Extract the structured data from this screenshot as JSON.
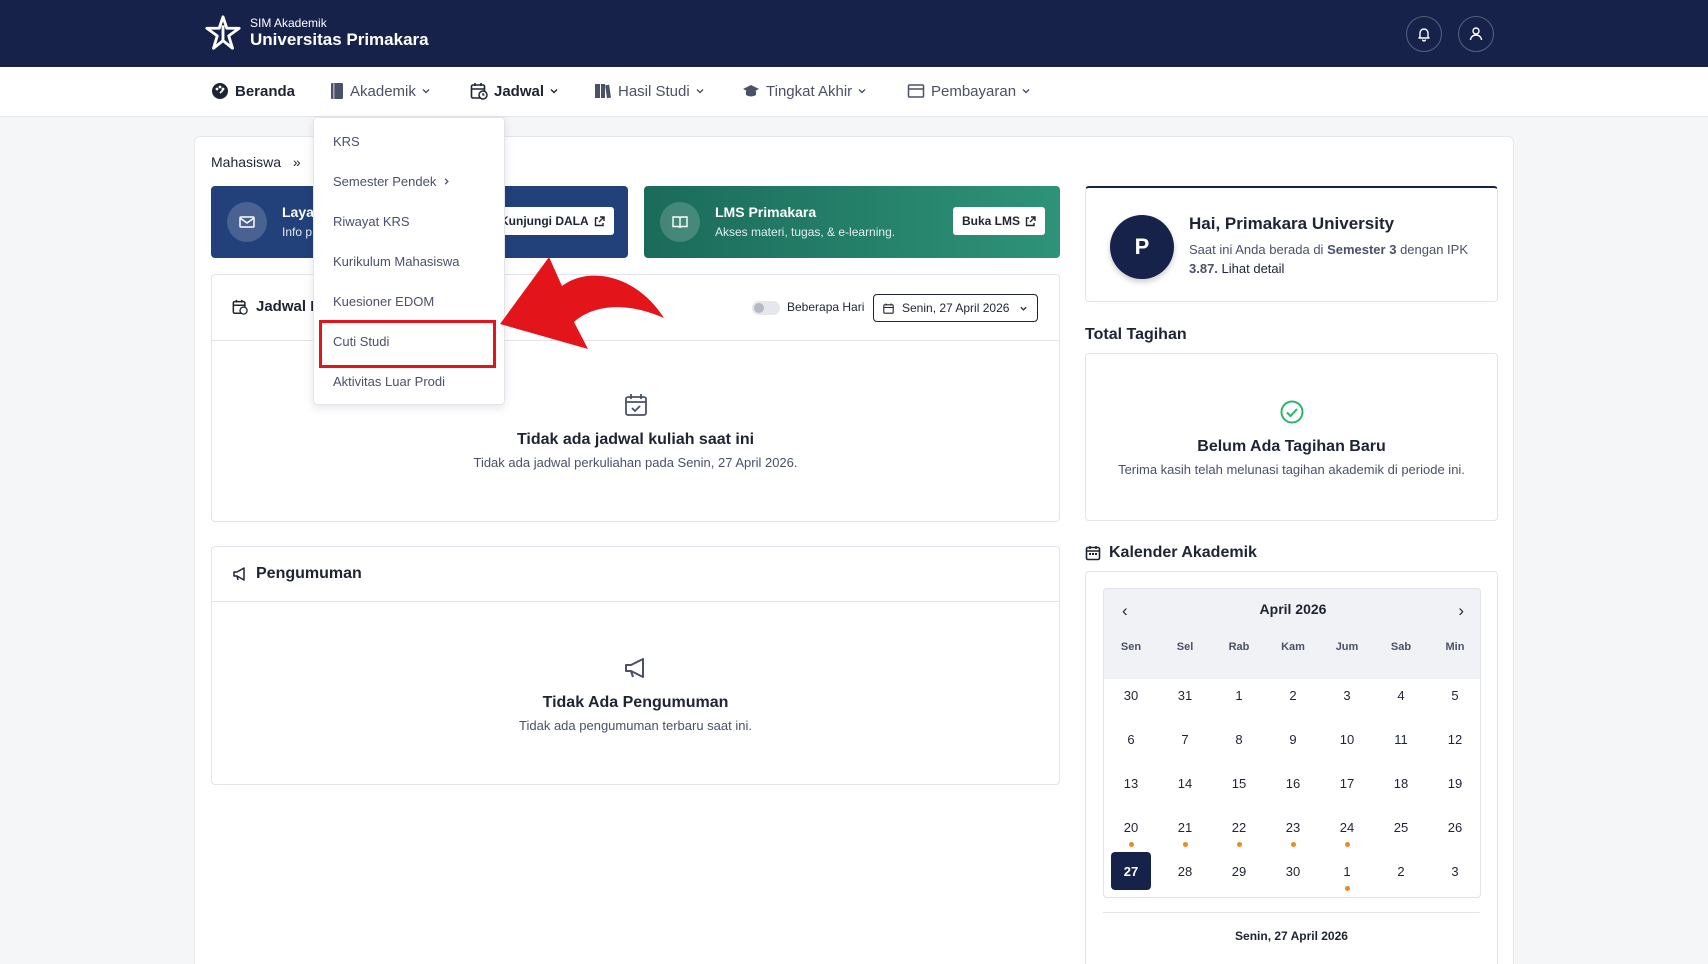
{
  "brand": {
    "subtitle": "SIM Akademik",
    "name": "Universitas Primakara"
  },
  "nav": {
    "items": [
      {
        "label": "Beranda"
      },
      {
        "label": "Akademik"
      },
      {
        "label": "Jadwal"
      },
      {
        "label": "Hasil Studi"
      },
      {
        "label": "Tingkat Akhir"
      },
      {
        "label": "Pembayaran"
      }
    ]
  },
  "akademik_menu": {
    "items": [
      {
        "label": "KRS"
      },
      {
        "label": "Semester Pendek"
      },
      {
        "label": "Riwayat KRS"
      },
      {
        "label": "Kurikulum Mahasiswa"
      },
      {
        "label": "Kuesioner EDOM"
      },
      {
        "label": "Cuti Studi"
      },
      {
        "label": "Aktivitas Luar Prodi"
      }
    ]
  },
  "breadcrumb": {
    "root": "Mahasiswa",
    "separator": "»"
  },
  "banners": {
    "layanan": {
      "title": "Laya",
      "sub": "Info p",
      "button": "Kunjungi DALA"
    },
    "lms": {
      "title": "LMS Primakara",
      "sub": "Akses materi, tugas, & e-learning.",
      "button": "Buka LMS"
    }
  },
  "schedule": {
    "title": "Jadwal K",
    "toggle_label": "Beberapa Hari",
    "date": "Senin, 27 April 2026",
    "empty_title": "Tidak ada jadwal kuliah saat ini",
    "empty_sub": "Tidak ada jadwal perkuliahan pada Senin, 27 April 2026."
  },
  "announcements": {
    "title": "Pengumuman",
    "empty_title": "Tidak Ada Pengumuman",
    "empty_sub": "Tidak ada pengumuman terbaru saat ini."
  },
  "profile": {
    "initial": "P",
    "greeting": "Hai, Primakara University",
    "sub_prefix": "Saat ini Anda berada di ",
    "semester": "Semester 3",
    "sub_mid": " dengan IPK ",
    "ipk": "3.87.",
    "detail_link": "Lihat detail"
  },
  "billing": {
    "title": "Total Tagihan",
    "empty_title": "Belum Ada Tagihan Baru",
    "empty_sub": "Terima kasih telah melunasi tagihan akademik di periode ini."
  },
  "calendar": {
    "title": "Kalender Akademik",
    "month": "April 2026",
    "prev": "‹",
    "next": "›",
    "weekdays": [
      "Sen",
      "Sel",
      "Rab",
      "Kam",
      "Jum",
      "Sab",
      "Min"
    ],
    "days": [
      "30",
      "31",
      "1",
      "2",
      "3",
      "4",
      "5",
      "6",
      "7",
      "8",
      "9",
      "10",
      "11",
      "12",
      "13",
      "14",
      "15",
      "16",
      "17",
      "18",
      "19",
      "20",
      "21",
      "22",
      "23",
      "24",
      "25",
      "26",
      "27",
      "28",
      "29",
      "30",
      "1",
      "2",
      "3"
    ],
    "today_index": 28,
    "event_indices": [
      21,
      22,
      23,
      24,
      25,
      32
    ],
    "selected_date": "Senin, 27 April 2026"
  },
  "colors": {
    "navy": "#16224a",
    "accent_red": "#e3141a",
    "event_dot": "#e98a23",
    "success": "#2fb36b"
  }
}
